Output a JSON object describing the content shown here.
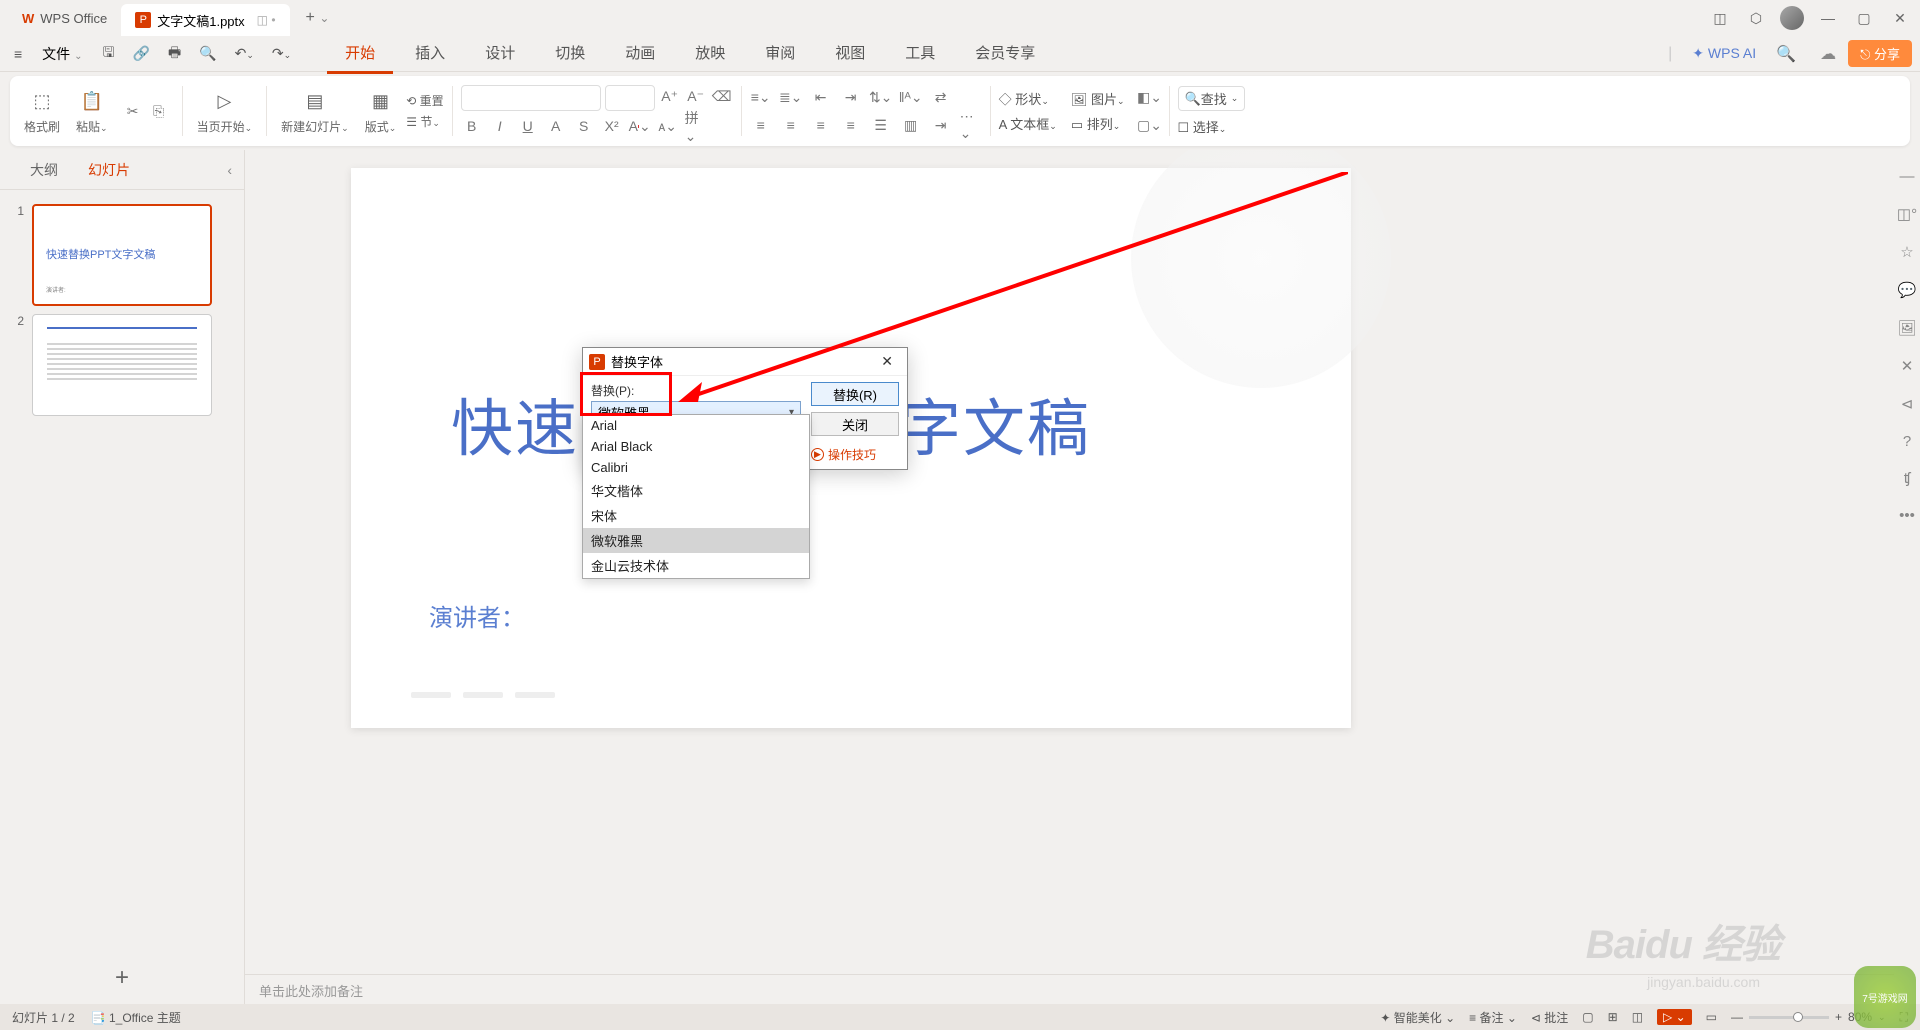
{
  "titlebar": {
    "home_tab": "WPS Office",
    "file_tab": "文字文稿1.pptx",
    "file_sub": "◫  •",
    "add": "+",
    "add_caret": "⌄"
  },
  "menubar": {
    "file": "文件",
    "tabs": [
      "开始",
      "插入",
      "设计",
      "切换",
      "动画",
      "放映",
      "审阅",
      "视图",
      "工具",
      "会员专享"
    ],
    "active_index": 0,
    "wps_ai": "WPS AI",
    "share": "分享"
  },
  "ribbon": {
    "format_brush": "格式刷",
    "paste": "粘贴",
    "start_page": "当页开始",
    "new_slide": "新建幻灯片",
    "layout": "版式",
    "section": "节",
    "reset": "重置",
    "shape": "形状",
    "textbox": "文本框",
    "picture": "图片",
    "arrange": "排列",
    "select": "选择",
    "find": "查找"
  },
  "sidepanel": {
    "outline": "大纲",
    "slides": "幻灯片",
    "thumb1_title": "快速替换PPT文字文稿",
    "thumb1_foot": "演讲者:",
    "add": "+"
  },
  "slide": {
    "title": "快速　　　　　字文稿",
    "presenter": "演讲者："
  },
  "dialog": {
    "title": "替换字体",
    "replace_label": "替换(P):",
    "combo_value": "微软雅黑",
    "btn_replace": "替换(R)",
    "btn_close": "关闭",
    "tips": "操作技巧",
    "fonts": [
      "Arial",
      "Arial Black",
      "Calibri",
      "华文楷体",
      "宋体",
      "微软雅黑",
      "金山云技术体"
    ],
    "highlight_index": 5
  },
  "notes": {
    "placeholder": "单击此处添加备注"
  },
  "statusbar": {
    "slide_info": "幻灯片 1 / 2",
    "theme": "1_Office 主题",
    "beautify": "智能美化",
    "notes": "备注",
    "review": "批注",
    "zoom": "80%"
  },
  "watermark": {
    "w1": "Baidu 经验",
    "w2": "jingyan.baidu.com",
    "w3": "7号游戏网"
  }
}
